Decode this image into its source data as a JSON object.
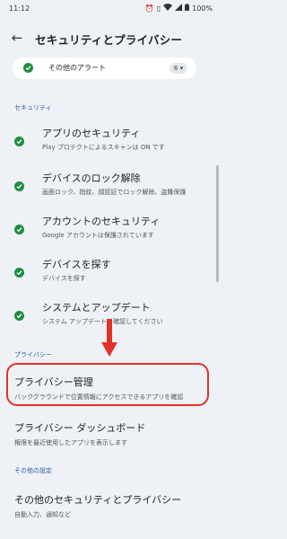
{
  "status_bar": {
    "time": "11:12",
    "battery": "100%"
  },
  "app_bar": {
    "title": "セキュリティとプライバシー"
  },
  "alert_card": {
    "label": "その他のアラート",
    "count": "6"
  },
  "sections": {
    "security": "セキュリティ",
    "privacy": "プライバシー",
    "other": "その他の設定"
  },
  "security_items": [
    {
      "title": "アプリのセキュリティ",
      "subtitle": "Play プロテクトによるスキャンは ON です"
    },
    {
      "title": "デバイスのロック解除",
      "subtitle": "画面ロック、指紋、顔認証でロック解除、盗難保護"
    },
    {
      "title": "アカウントのセキュリティ",
      "subtitle": "Google アカウントは保護されています"
    },
    {
      "title": "デバイスを探す",
      "subtitle": "デバイスを探す"
    },
    {
      "title": "システムとアップデート",
      "subtitle": "システム アップデートを確認してください"
    }
  ],
  "privacy_items": [
    {
      "title": "プライバシー管理",
      "subtitle": "バックグラウンドで位置情報にアクセスできるアプリを確認"
    },
    {
      "title": "プライバシー ダッシュボード",
      "subtitle": "権限を最近使用したアプリを表示します"
    }
  ],
  "other_items": [
    {
      "title": "その他のセキュリティとプライバシー",
      "subtitle": "自動入力、通知など"
    }
  ],
  "colors": {
    "check": "#1e8e3e",
    "highlight": "#e0322a",
    "section": "#2f5e9e"
  }
}
